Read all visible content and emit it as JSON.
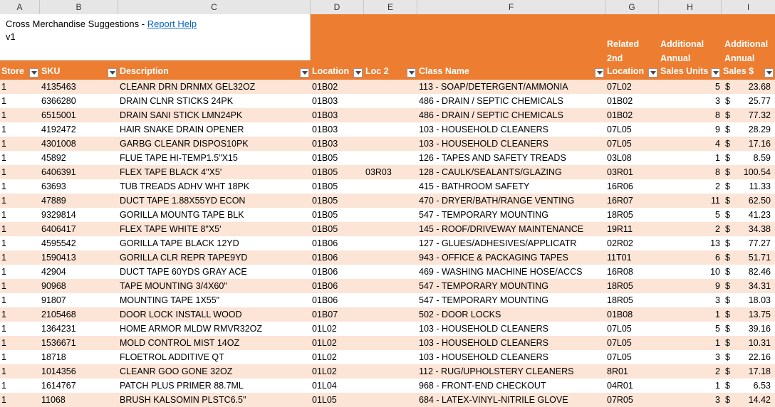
{
  "column_letters": [
    "A",
    "B",
    "C",
    "D",
    "E",
    "F",
    "G",
    "H",
    "I"
  ],
  "title": {
    "text": "Cross Merchandise Suggestions - ",
    "link": "Report Help",
    "version": "v1"
  },
  "headers": {
    "store": "Store",
    "sku": "SKU",
    "description": "Description",
    "location": "Location",
    "loc2": "Loc 2",
    "class_name": "Class Name",
    "related_l1": "Related",
    "related_l2": "2nd",
    "related_l3": "Location",
    "units_l1": "Additional",
    "units_l2": "Annual",
    "units_l3": "Sales Units",
    "sales_l1": "Additional",
    "sales_l2": "Annual",
    "sales_l3": "Sales $"
  },
  "rows": [
    {
      "store": "1",
      "sku": "4135463",
      "desc": "CLEANR DRN DRNMX GEL32OZ",
      "loc": "01B02",
      "loc2": "",
      "cls": "113 - SOAP/DETERGENT/AMMONIA",
      "rel": "07L02",
      "units": "5",
      "cur": "$",
      "sales": "23.68"
    },
    {
      "store": "1",
      "sku": "6366280",
      "desc": "DRAIN CLNR STICKS 24PK",
      "loc": "01B03",
      "loc2": "",
      "cls": "486 - DRAIN / SEPTIC CHEMICALS",
      "rel": "01B02",
      "units": "3",
      "cur": "$",
      "sales": "25.77"
    },
    {
      "store": "1",
      "sku": "6515001",
      "desc": "DRAIN SANI STICK LMN24PK",
      "loc": "01B03",
      "loc2": "",
      "cls": "486 - DRAIN / SEPTIC CHEMICALS",
      "rel": "01B02",
      "units": "8",
      "cur": "$",
      "sales": "77.32"
    },
    {
      "store": "1",
      "sku": "4192472",
      "desc": "HAIR SNAKE DRAIN OPENER",
      "loc": "01B03",
      "loc2": "",
      "cls": "103 - HOUSEHOLD CLEANERS",
      "rel": "07L05",
      "units": "9",
      "cur": "$",
      "sales": "28.29"
    },
    {
      "store": "1",
      "sku": "4301008",
      "desc": "GARBG CLEANR DISPOS10PK",
      "loc": "01B03",
      "loc2": "",
      "cls": "103 - HOUSEHOLD CLEANERS",
      "rel": "07L05",
      "units": "4",
      "cur": "$",
      "sales": "17.16"
    },
    {
      "store": "1",
      "sku": "45892",
      "desc": "FLUE TAPE HI-TEMP1.5\"X15",
      "loc": "01B05",
      "loc2": "",
      "cls": "126 - TAPES AND SAFETY TREADS",
      "rel": "03L08",
      "units": "1",
      "cur": "$",
      "sales": "8.59"
    },
    {
      "store": "1",
      "sku": "6406391",
      "desc": "FLEX TAPE BLACK 4\"X5'",
      "loc": "01B05",
      "loc2": "03R03",
      "cls": "128 - CAULK/SEALANTS/GLAZING",
      "rel": "03R01",
      "units": "8",
      "cur": "$",
      "sales": "100.54"
    },
    {
      "store": "1",
      "sku": "63693",
      "desc": "TUB TREADS ADHV WHT 18PK",
      "loc": "01B05",
      "loc2": "",
      "cls": "415 - BATHROOM SAFETY",
      "rel": "16R06",
      "units": "2",
      "cur": "$",
      "sales": "11.33"
    },
    {
      "store": "1",
      "sku": "47889",
      "desc": "DUCT TAPE 1.88X55YD ECON",
      "loc": "01B05",
      "loc2": "",
      "cls": "470 - DRYER/BATH/RANGE VENTING",
      "rel": "16R07",
      "units": "11",
      "cur": "$",
      "sales": "62.50"
    },
    {
      "store": "1",
      "sku": "9329814",
      "desc": "GORILLA MOUNTG TAPE BLK",
      "loc": "01B05",
      "loc2": "",
      "cls": "547 - TEMPORARY MOUNTING",
      "rel": "18R05",
      "units": "5",
      "cur": "$",
      "sales": "41.23"
    },
    {
      "store": "1",
      "sku": "6406417",
      "desc": "FLEX TAPE WHITE 8\"X5'",
      "loc": "01B05",
      "loc2": "",
      "cls": "145 - ROOF/DRIVEWAY MAINTENANCE",
      "rel": "19R11",
      "units": "2",
      "cur": "$",
      "sales": "34.38"
    },
    {
      "store": "1",
      "sku": "4595542",
      "desc": "GORILLA TAPE BLACK 12YD",
      "loc": "01B06",
      "loc2": "",
      "cls": "127 - GLUES/ADHESIVES/APPLICATR",
      "rel": "02R02",
      "units": "13",
      "cur": "$",
      "sales": "77.27"
    },
    {
      "store": "1",
      "sku": "1590413",
      "desc": "GORILLA CLR REPR TAPE9YD",
      "loc": "01B06",
      "loc2": "",
      "cls": "943 - OFFICE & PACKAGING TAPES",
      "rel": "11T01",
      "units": "6",
      "cur": "$",
      "sales": "51.71"
    },
    {
      "store": "1",
      "sku": "42904",
      "desc": "DUCT TAPE 60YDS GRAY ACE",
      "loc": "01B06",
      "loc2": "",
      "cls": "469 - WASHING MACHINE HOSE/ACCS",
      "rel": "16R08",
      "units": "10",
      "cur": "$",
      "sales": "82.46"
    },
    {
      "store": "1",
      "sku": "90968",
      "desc": "TAPE MOUNTING 3/4X60\"",
      "loc": "01B06",
      "loc2": "",
      "cls": "547 - TEMPORARY MOUNTING",
      "rel": "18R05",
      "units": "9",
      "cur": "$",
      "sales": "34.31"
    },
    {
      "store": "1",
      "sku": "91807",
      "desc": "MOUNTING TAPE 1X55\"",
      "loc": "01B06",
      "loc2": "",
      "cls": "547 - TEMPORARY MOUNTING",
      "rel": "18R05",
      "units": "3",
      "cur": "$",
      "sales": "18.03"
    },
    {
      "store": "1",
      "sku": "2105468",
      "desc": "DOOR LOCK INSTALL WOOD",
      "loc": "01B07",
      "loc2": "",
      "cls": "502 - DOOR LOCKS",
      "rel": "01B08",
      "units": "1",
      "cur": "$",
      "sales": "13.75"
    },
    {
      "store": "1",
      "sku": "1364231",
      "desc": "HOME ARMOR MLDW RMVR32OZ",
      "loc": "01L02",
      "loc2": "",
      "cls": "103 - HOUSEHOLD CLEANERS",
      "rel": "07L05",
      "units": "5",
      "cur": "$",
      "sales": "39.16"
    },
    {
      "store": "1",
      "sku": "1536671",
      "desc": "MOLD CONTROL MIST 14OZ",
      "loc": "01L02",
      "loc2": "",
      "cls": "103 - HOUSEHOLD CLEANERS",
      "rel": "07L05",
      "units": "1",
      "cur": "$",
      "sales": "10.31"
    },
    {
      "store": "1",
      "sku": "18718",
      "desc": "FLOETROL ADDITIVE QT",
      "loc": "01L02",
      "loc2": "",
      "cls": "103 - HOUSEHOLD CLEANERS",
      "rel": "07L05",
      "units": "3",
      "cur": "$",
      "sales": "22.16"
    },
    {
      "store": "1",
      "sku": "1014356",
      "desc": "CLEANR GOO GONE 32OZ",
      "loc": "01L02",
      "loc2": "",
      "cls": "112 - RUG/UPHOLSTERY CLEANERS",
      "rel": "8R01",
      "units": "2",
      "cur": "$",
      "sales": "17.18"
    },
    {
      "store": "1",
      "sku": "1614767",
      "desc": "PATCH PLUS PRIMER 88.7ML",
      "loc": "01L04",
      "loc2": "",
      "cls": "968 - FRONT-END CHECKOUT",
      "rel": "04R01",
      "units": "1",
      "cur": "$",
      "sales": "6.53"
    },
    {
      "store": "1",
      "sku": "11068",
      "desc": "BRUSH KALSOMIN PLSTC6.5\"",
      "loc": "01L05",
      "loc2": "",
      "cls": "684 - LATEX-VINYL-NITRILE GLOVE",
      "rel": "07R05",
      "units": "3",
      "cur": "$",
      "sales": "14.42"
    }
  ]
}
